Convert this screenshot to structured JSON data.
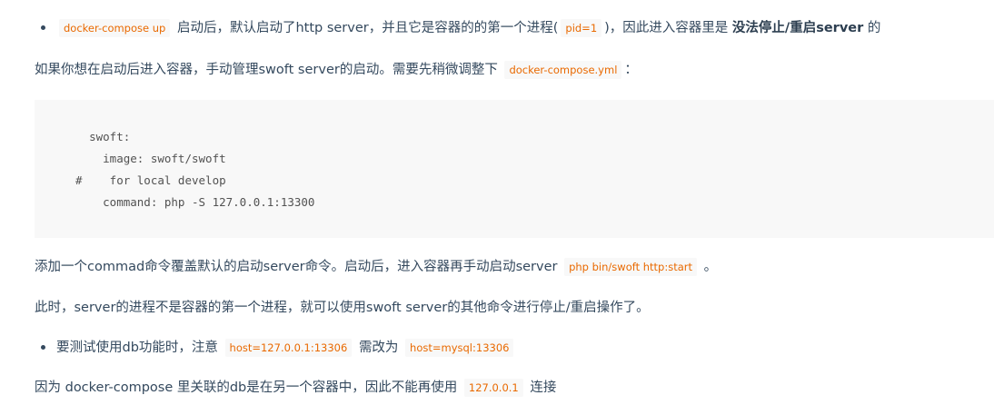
{
  "bullet1": {
    "code1": "docker-compose up",
    "text1": "启动后，默认启动了http server，并且它是容器的的第一个进程(",
    "code2": "pid=1",
    "text2": ")，因此进入容器里是",
    "bold": "没法停止/重启server",
    "text3": "的"
  },
  "para1": {
    "text1": "如果你想在启动后进入容器，手动管理swoft server的启动。需要先稍微调整下",
    "code": "docker-compose.yml",
    "text2": "："
  },
  "code_block": {
    "lines": [
      "    swoft:",
      "      image: swoft/swoft",
      "  #    for local develop",
      "      command: php -S 127.0.0.1:13300"
    ]
  },
  "para2": {
    "text1": "添加一个commad命令覆盖默认的启动server命令。启动后，进入容器再手动启动server",
    "code": "php bin/swoft http:start",
    "text2": "。"
  },
  "para3": {
    "text": "此时，server的进程不是容器的第一个进程，就可以使用swoft server的其他命令进行停止/重启操作了。"
  },
  "bullet2": {
    "text1": "要测试使用db功能时，注意",
    "code1": "host=127.0.0.1:13306",
    "text2": "需改为",
    "code2": "host=mysql:13306"
  },
  "para4": {
    "text1": "因为 docker-compose 里关联的db是在另一个容器中，因此不能再使用",
    "code": "127.0.0.1",
    "text2": "连接"
  }
}
